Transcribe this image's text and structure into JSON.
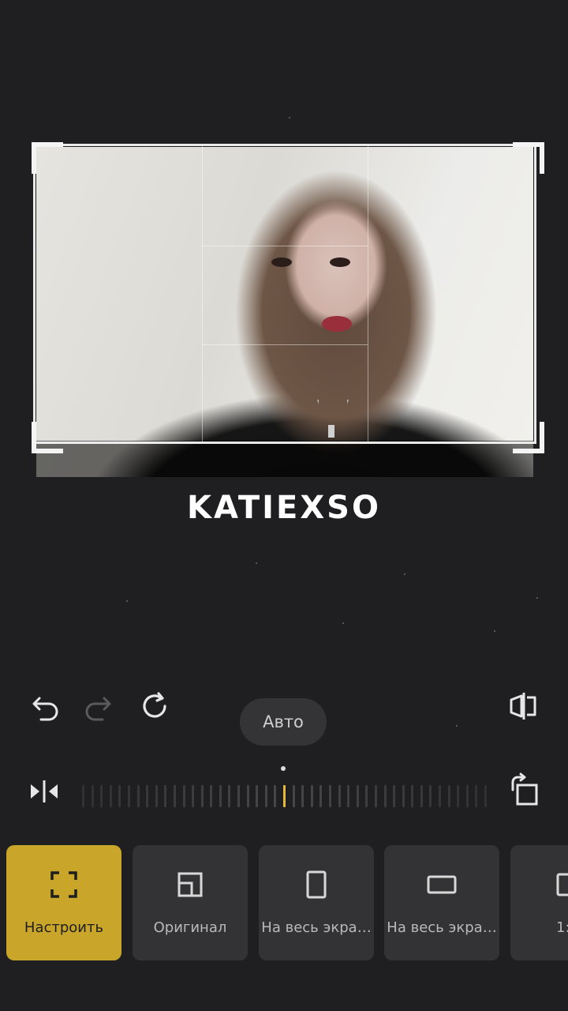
{
  "preview": {
    "watermark": "KATIEXSO"
  },
  "controls": {
    "undo_icon": "undo-icon",
    "redo_icon": "redo-icon",
    "reset_icon": "reset-rotate-icon",
    "mirror_icon": "mirror-icon",
    "auto_label": "Авто",
    "flip_icon": "flip-horizontal-icon",
    "rotate_icon": "rotate-90-icon",
    "straighten_level": 0,
    "accent_color": "#e2b93b"
  },
  "aspect_options": [
    {
      "label": "Настроить",
      "icon": "free-crop-icon",
      "selected": true
    },
    {
      "label": "Оригинал",
      "icon": "original-ratio-icon",
      "selected": false
    },
    {
      "label": "На весь экра…",
      "icon": "portrait-fullscreen-icon",
      "selected": false
    },
    {
      "label": "На весь экра…",
      "icon": "landscape-fullscreen-icon",
      "selected": false
    },
    {
      "label": "1:",
      "icon": "square-ratio-icon",
      "selected": false
    }
  ]
}
